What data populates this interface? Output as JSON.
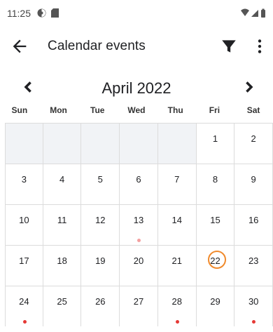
{
  "status_bar": {
    "time": "11:25",
    "left_icons": [
      "vpn-icon",
      "sd-card-icon"
    ],
    "right_icons": [
      "wifi-icon",
      "signal-icon",
      "battery-icon"
    ]
  },
  "app_bar": {
    "title": "Calendar events",
    "back_icon": "arrow-back-icon",
    "filter_icon": "filter-icon",
    "more_icon": "more-vert-icon"
  },
  "calendar": {
    "month_label": "April 2022",
    "weekdays": [
      "Sun",
      "Mon",
      "Tue",
      "Wed",
      "Thu",
      "Fri",
      "Sat"
    ],
    "weeks": [
      [
        "",
        "",
        "",
        "",
        "",
        "1",
        "2"
      ],
      [
        "3",
        "4",
        "5",
        "6",
        "7",
        "8",
        "9"
      ],
      [
        "10",
        "11",
        "12",
        "13",
        "14",
        "15",
        "16"
      ],
      [
        "17",
        "18",
        "19",
        "20",
        "21",
        "22",
        "23"
      ],
      [
        "24",
        "25",
        "26",
        "27",
        "28",
        "29",
        "30"
      ]
    ],
    "today": "22",
    "event_dots": {
      "13": "light",
      "24": "dark",
      "28": "dark",
      "30": "dark"
    },
    "colors": {
      "today_ring": "#f08a2c",
      "event_dot": "#e53935",
      "event_dot_light": "#f4a0a0",
      "empty_cell": "#f1f3f6"
    }
  }
}
